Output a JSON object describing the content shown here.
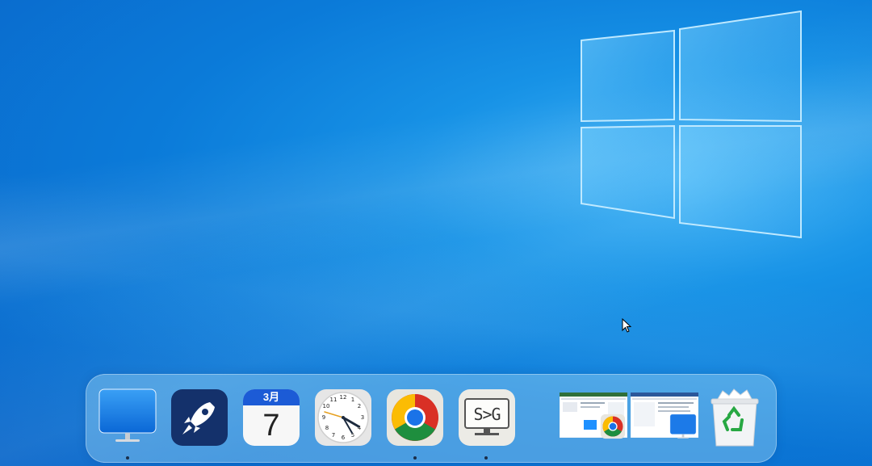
{
  "desktop": {
    "wallpaper": "windows-10-hero",
    "accent": "#0b7bd9"
  },
  "dock": {
    "items": [
      {
        "name": "desktop",
        "icon": "monitor-icon",
        "running": true
      },
      {
        "name": "launchpad",
        "icon": "rocket-icon",
        "running": false
      },
      {
        "name": "calendar",
        "icon": "calendar-icon",
        "month": "3月",
        "day": "7",
        "running": false
      },
      {
        "name": "clock",
        "icon": "clock-icon",
        "running": false
      },
      {
        "name": "chrome",
        "icon": "chrome-icon",
        "running": true
      },
      {
        "name": "s-to-g",
        "icon": "terminal-icon",
        "label": "S>G",
        "running": true
      }
    ],
    "minimized_windows": [
      {
        "app_icon": "chrome-icon"
      },
      {
        "app_icon": "monitor-icon"
      }
    ],
    "trash": {
      "icon": "recycle-bin-icon"
    }
  }
}
